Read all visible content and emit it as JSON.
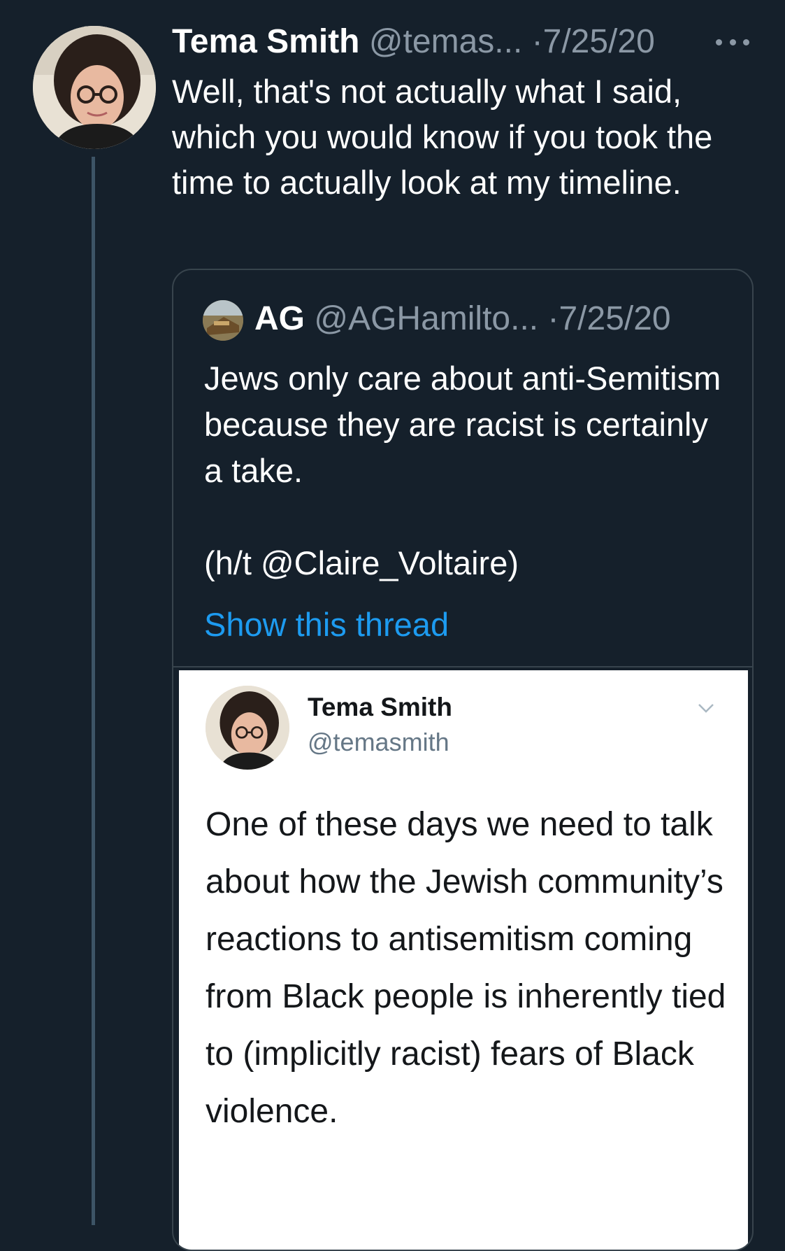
{
  "tweet": {
    "author_name": "Tema Smith",
    "author_handle": "@temas...",
    "date": "·7/25/20",
    "text": "Well, that's not actually what I said, which you would know if you took the time to actually look at my timeline."
  },
  "icons": {
    "more": "more-horizontal-icon",
    "chevron": "chevron-down-icon"
  },
  "quote": {
    "author_name": "AG",
    "author_handle": "@AGHamilto...",
    "date": "·7/25/20",
    "text": "Jews only care about anti-Semitism because they are racist is certainly a take.\n\n(h/t @Claire_Voltaire)",
    "show_thread": "Show this thread"
  },
  "embedded_tweet": {
    "author_name": "Tema Smith",
    "author_handle": "@temasmith",
    "text": "One of these days we need to talk about how the Jewish community’s reactions to antisemitism coming from Black people is inherently tied to (implicitly racist) fears of Black violence."
  },
  "colors": {
    "background": "#15202b",
    "secondary_text": "#8b98a5",
    "link": "#1d9bf0",
    "border": "#38444d"
  }
}
